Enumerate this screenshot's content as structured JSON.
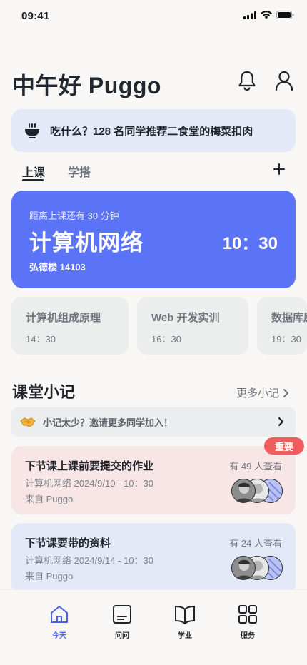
{
  "status": {
    "time": "09:41"
  },
  "header": {
    "greeting": "中午好 Puggo"
  },
  "banner": {
    "text": "吃什么？128 名同学推荐二食堂的梅菜扣肉"
  },
  "tabs": [
    {
      "label": "上课"
    },
    {
      "label": "学搭"
    }
  ],
  "current_class": {
    "countdown": "距离上课还有 30 分钟",
    "name": "计算机网络",
    "time": "10：30",
    "location": "弘德楼 14103"
  },
  "upcoming": [
    {
      "name": "计算机组成原理",
      "time": "14：30"
    },
    {
      "name": "Web 开发实训",
      "time": "16：30"
    },
    {
      "name": "数据库原理",
      "time": "19：30"
    }
  ],
  "notes_section": {
    "title": "课堂小记",
    "more": "更多小记",
    "invite": "小记太少？邀请更多同学加入！"
  },
  "notes": [
    {
      "title": "下节课上课前要提交的作业",
      "views": "有 49 人查看",
      "meta": "计算机网络  2024/9/10 - 10：30",
      "from": "来自 Puggo",
      "badge": "重要",
      "bg": "#f7e6e5"
    },
    {
      "title": "下节课要带的资料",
      "views": "有 24 人查看",
      "meta": "计算机网络  2024/9/14 - 10：30",
      "from": "来自 Puggo",
      "bg": "#e4e9f7"
    }
  ],
  "nav": [
    {
      "label": "今天",
      "icon": "home-icon"
    },
    {
      "label": "问问",
      "icon": "chat-icon"
    },
    {
      "label": "学业",
      "icon": "book-icon"
    },
    {
      "label": "服务",
      "icon": "grid-icon"
    }
  ],
  "colors": {
    "accent": "#5b73f6",
    "badge": "#ee5d5d",
    "nav_active": "#4a62e8"
  }
}
